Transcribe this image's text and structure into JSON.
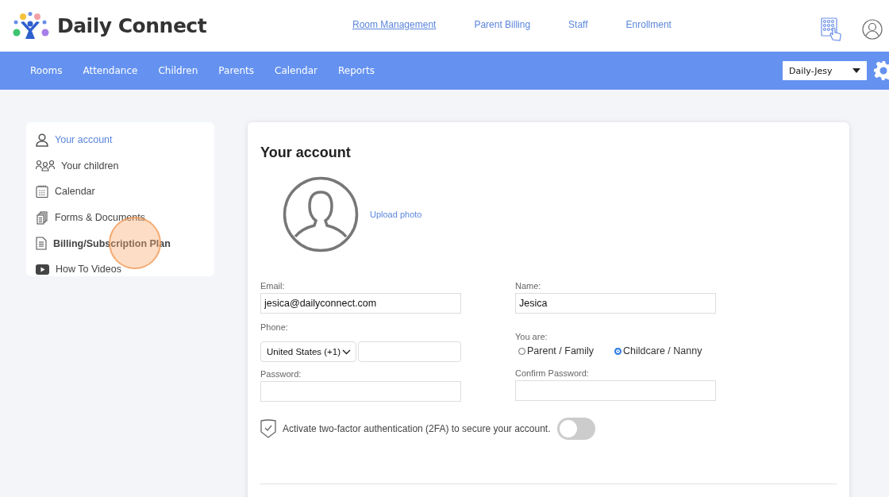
{
  "brand": {
    "name": "Daily Connect"
  },
  "top_links": [
    {
      "label": "Room Management",
      "selected": true
    },
    {
      "label": "Parent Billing",
      "selected": false
    },
    {
      "label": "Staff",
      "selected": false
    },
    {
      "label": "Enrollment",
      "selected": false
    }
  ],
  "nav_tabs": [
    "Rooms",
    "Attendance",
    "Children",
    "Parents",
    "Calendar",
    "Reports"
  ],
  "account_select": {
    "value": "Daily-Jesy"
  },
  "sidebar": {
    "items": [
      {
        "label": "Your account",
        "kind": "person",
        "selected": true,
        "bold": false,
        "click_highlight": false
      },
      {
        "label": "Your children",
        "kind": "people",
        "selected": false,
        "bold": false,
        "click_highlight": false
      },
      {
        "label": "Calendar",
        "kind": "calendar",
        "selected": false,
        "bold": false,
        "click_highlight": false
      },
      {
        "label": "Forms & Documents",
        "kind": "documents",
        "selected": false,
        "bold": false,
        "click_highlight": false
      },
      {
        "label": "Billing/Subscription Plan",
        "kind": "document",
        "selected": false,
        "bold": true,
        "click_highlight": true
      },
      {
        "label": "How To Videos",
        "kind": "video",
        "selected": false,
        "bold": false,
        "click_highlight": false
      }
    ]
  },
  "account": {
    "title": "Your account",
    "upload_link": "Upload photo",
    "email": {
      "label": "Email:",
      "value": "jesica@dailyconnect.com"
    },
    "name": {
      "label": "Name:",
      "value": "Jesica"
    },
    "phone": {
      "label": "Phone:",
      "country": "United States (+1)"
    },
    "role": {
      "label": "You are:",
      "options": [
        {
          "label": "Parent / Family",
          "selected": false
        },
        {
          "label": "Childcare / Nanny",
          "selected": true
        }
      ]
    },
    "password": {
      "label": "Password:"
    },
    "confirm_password": {
      "label": "Confirm Password:"
    },
    "two_factor": {
      "text": "Activate two-factor authentication (2FA) to secure your account.",
      "on": false
    }
  }
}
